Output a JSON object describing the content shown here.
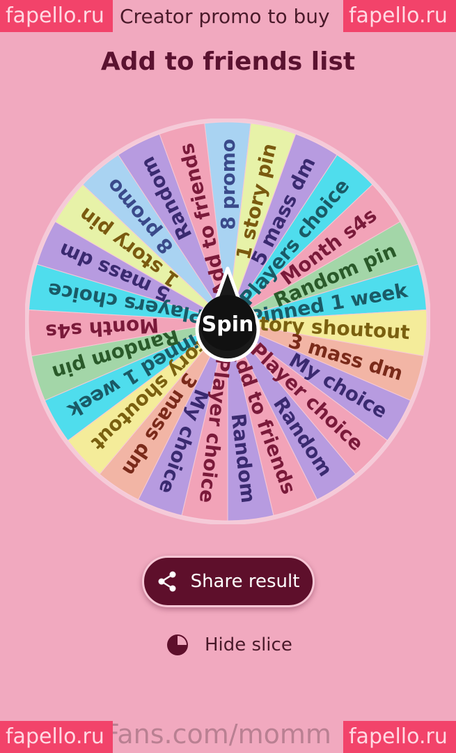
{
  "top_bar": {
    "left_glyph": "←",
    "title": "Creator promo to buy"
  },
  "heading": "Add to friends list",
  "spin_label": "Spin",
  "wheel": {
    "slices": [
      "8 promo",
      "1 story pin",
      "5 mass dm",
      "Players choice",
      "Month s4s",
      "Random pin",
      "Pinned 1 week",
      "Story shoutout",
      "3 mass dm",
      "My choice",
      "Player choice",
      "Random",
      "Add to friends",
      "Random",
      "Player choice",
      "My choice",
      "3 mass dm",
      "Story shoutout",
      "Pinned 1 week",
      "Random pin",
      "Month s4s",
      "Players choice",
      "5 mass dm",
      "1 story pin",
      "8 promo",
      "Random",
      "Add to friends"
    ],
    "colors": [
      "#a9d3f2",
      "#e7f2a8",
      "#b79be0",
      "#4fdded",
      "#f2a3b8",
      "#a3d6a8",
      "#4fdded",
      "#f4ec9a",
      "#f2b5a5",
      "#b79be0",
      "#f2a3b8",
      "#b79be0",
      "#f2a3b8",
      "#b79be0",
      "#f2a3b8",
      "#b79be0",
      "#f2b5a5",
      "#f4ec9a",
      "#4fdded",
      "#a3d6a8",
      "#f2a3b8",
      "#4fdded",
      "#b79be0",
      "#e7f2a8",
      "#a9d3f2",
      "#b79be0",
      "#f2a3b8"
    ],
    "text_colors": [
      "#3a4a8a",
      "#7a5a10",
      "#3a2a70",
      "#1a5a66",
      "#7a1a3a",
      "#2a5a2a",
      "#1a5a66",
      "#7a6010",
      "#7a2a1a",
      "#3a2a70",
      "#7a1a3a",
      "#3a2a70",
      "#7a1a3a",
      "#3a2a70",
      "#7a1a3a",
      "#3a2a70",
      "#7a2a1a",
      "#7a6010",
      "#1a5a66",
      "#2a5a2a",
      "#7a1a3a",
      "#1a5a66",
      "#3a2a70",
      "#7a5a10",
      "#3a4a8a",
      "#3a2a70",
      "#7a1a3a"
    ]
  },
  "share_button": {
    "label": "Share result",
    "icon": "share-icon"
  },
  "hide_slice": {
    "label": "Hide slice",
    "icon": "pie-chart-icon"
  },
  "watermarks": {
    "text": "fapello.ru"
  },
  "bottom_overlay": "Fans.com/momm"
}
